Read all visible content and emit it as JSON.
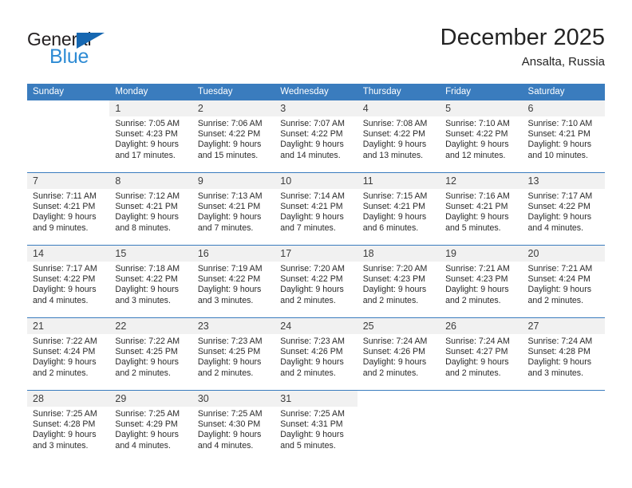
{
  "brand": {
    "name_top": "General",
    "name_bottom": "Blue",
    "triangle_color": "#1667b1",
    "blue_color": "#2e8bd4"
  },
  "header": {
    "month_title": "December 2025",
    "location": "Ansalta, Russia"
  },
  "theme": {
    "header_bg": "#3a7cbe",
    "daynum_bg": "#f1f1f1",
    "grid_line": "#3a7cbe"
  },
  "weekday_headers": [
    "Sunday",
    "Monday",
    "Tuesday",
    "Wednesday",
    "Thursday",
    "Friday",
    "Saturday"
  ],
  "weeks": [
    [
      {
        "day": "",
        "sunrise": "",
        "sunset": "",
        "daylight_line1": "",
        "daylight_line2": ""
      },
      {
        "day": "1",
        "sunrise": "Sunrise: 7:05 AM",
        "sunset": "Sunset: 4:23 PM",
        "daylight_line1": "Daylight: 9 hours",
        "daylight_line2": "and 17 minutes."
      },
      {
        "day": "2",
        "sunrise": "Sunrise: 7:06 AM",
        "sunset": "Sunset: 4:22 PM",
        "daylight_line1": "Daylight: 9 hours",
        "daylight_line2": "and 15 minutes."
      },
      {
        "day": "3",
        "sunrise": "Sunrise: 7:07 AM",
        "sunset": "Sunset: 4:22 PM",
        "daylight_line1": "Daylight: 9 hours",
        "daylight_line2": "and 14 minutes."
      },
      {
        "day": "4",
        "sunrise": "Sunrise: 7:08 AM",
        "sunset": "Sunset: 4:22 PM",
        "daylight_line1": "Daylight: 9 hours",
        "daylight_line2": "and 13 minutes."
      },
      {
        "day": "5",
        "sunrise": "Sunrise: 7:10 AM",
        "sunset": "Sunset: 4:22 PM",
        "daylight_line1": "Daylight: 9 hours",
        "daylight_line2": "and 12 minutes."
      },
      {
        "day": "6",
        "sunrise": "Sunrise: 7:10 AM",
        "sunset": "Sunset: 4:21 PM",
        "daylight_line1": "Daylight: 9 hours",
        "daylight_line2": "and 10 minutes."
      }
    ],
    [
      {
        "day": "7",
        "sunrise": "Sunrise: 7:11 AM",
        "sunset": "Sunset: 4:21 PM",
        "daylight_line1": "Daylight: 9 hours",
        "daylight_line2": "and 9 minutes."
      },
      {
        "day": "8",
        "sunrise": "Sunrise: 7:12 AM",
        "sunset": "Sunset: 4:21 PM",
        "daylight_line1": "Daylight: 9 hours",
        "daylight_line2": "and 8 minutes."
      },
      {
        "day": "9",
        "sunrise": "Sunrise: 7:13 AM",
        "sunset": "Sunset: 4:21 PM",
        "daylight_line1": "Daylight: 9 hours",
        "daylight_line2": "and 7 minutes."
      },
      {
        "day": "10",
        "sunrise": "Sunrise: 7:14 AM",
        "sunset": "Sunset: 4:21 PM",
        "daylight_line1": "Daylight: 9 hours",
        "daylight_line2": "and 7 minutes."
      },
      {
        "day": "11",
        "sunrise": "Sunrise: 7:15 AM",
        "sunset": "Sunset: 4:21 PM",
        "daylight_line1": "Daylight: 9 hours",
        "daylight_line2": "and 6 minutes."
      },
      {
        "day": "12",
        "sunrise": "Sunrise: 7:16 AM",
        "sunset": "Sunset: 4:21 PM",
        "daylight_line1": "Daylight: 9 hours",
        "daylight_line2": "and 5 minutes."
      },
      {
        "day": "13",
        "sunrise": "Sunrise: 7:17 AM",
        "sunset": "Sunset: 4:22 PM",
        "daylight_line1": "Daylight: 9 hours",
        "daylight_line2": "and 4 minutes."
      }
    ],
    [
      {
        "day": "14",
        "sunrise": "Sunrise: 7:17 AM",
        "sunset": "Sunset: 4:22 PM",
        "daylight_line1": "Daylight: 9 hours",
        "daylight_line2": "and 4 minutes."
      },
      {
        "day": "15",
        "sunrise": "Sunrise: 7:18 AM",
        "sunset": "Sunset: 4:22 PM",
        "daylight_line1": "Daylight: 9 hours",
        "daylight_line2": "and 3 minutes."
      },
      {
        "day": "16",
        "sunrise": "Sunrise: 7:19 AM",
        "sunset": "Sunset: 4:22 PM",
        "daylight_line1": "Daylight: 9 hours",
        "daylight_line2": "and 3 minutes."
      },
      {
        "day": "17",
        "sunrise": "Sunrise: 7:20 AM",
        "sunset": "Sunset: 4:22 PM",
        "daylight_line1": "Daylight: 9 hours",
        "daylight_line2": "and 2 minutes."
      },
      {
        "day": "18",
        "sunrise": "Sunrise: 7:20 AM",
        "sunset": "Sunset: 4:23 PM",
        "daylight_line1": "Daylight: 9 hours",
        "daylight_line2": "and 2 minutes."
      },
      {
        "day": "19",
        "sunrise": "Sunrise: 7:21 AM",
        "sunset": "Sunset: 4:23 PM",
        "daylight_line1": "Daylight: 9 hours",
        "daylight_line2": "and 2 minutes."
      },
      {
        "day": "20",
        "sunrise": "Sunrise: 7:21 AM",
        "sunset": "Sunset: 4:24 PM",
        "daylight_line1": "Daylight: 9 hours",
        "daylight_line2": "and 2 minutes."
      }
    ],
    [
      {
        "day": "21",
        "sunrise": "Sunrise: 7:22 AM",
        "sunset": "Sunset: 4:24 PM",
        "daylight_line1": "Daylight: 9 hours",
        "daylight_line2": "and 2 minutes."
      },
      {
        "day": "22",
        "sunrise": "Sunrise: 7:22 AM",
        "sunset": "Sunset: 4:25 PM",
        "daylight_line1": "Daylight: 9 hours",
        "daylight_line2": "and 2 minutes."
      },
      {
        "day": "23",
        "sunrise": "Sunrise: 7:23 AM",
        "sunset": "Sunset: 4:25 PM",
        "daylight_line1": "Daylight: 9 hours",
        "daylight_line2": "and 2 minutes."
      },
      {
        "day": "24",
        "sunrise": "Sunrise: 7:23 AM",
        "sunset": "Sunset: 4:26 PM",
        "daylight_line1": "Daylight: 9 hours",
        "daylight_line2": "and 2 minutes."
      },
      {
        "day": "25",
        "sunrise": "Sunrise: 7:24 AM",
        "sunset": "Sunset: 4:26 PM",
        "daylight_line1": "Daylight: 9 hours",
        "daylight_line2": "and 2 minutes."
      },
      {
        "day": "26",
        "sunrise": "Sunrise: 7:24 AM",
        "sunset": "Sunset: 4:27 PM",
        "daylight_line1": "Daylight: 9 hours",
        "daylight_line2": "and 2 minutes."
      },
      {
        "day": "27",
        "sunrise": "Sunrise: 7:24 AM",
        "sunset": "Sunset: 4:28 PM",
        "daylight_line1": "Daylight: 9 hours",
        "daylight_line2": "and 3 minutes."
      }
    ],
    [
      {
        "day": "28",
        "sunrise": "Sunrise: 7:25 AM",
        "sunset": "Sunset: 4:28 PM",
        "daylight_line1": "Daylight: 9 hours",
        "daylight_line2": "and 3 minutes."
      },
      {
        "day": "29",
        "sunrise": "Sunrise: 7:25 AM",
        "sunset": "Sunset: 4:29 PM",
        "daylight_line1": "Daylight: 9 hours",
        "daylight_line2": "and 4 minutes."
      },
      {
        "day": "30",
        "sunrise": "Sunrise: 7:25 AM",
        "sunset": "Sunset: 4:30 PM",
        "daylight_line1": "Daylight: 9 hours",
        "daylight_line2": "and 4 minutes."
      },
      {
        "day": "31",
        "sunrise": "Sunrise: 7:25 AM",
        "sunset": "Sunset: 4:31 PM",
        "daylight_line1": "Daylight: 9 hours",
        "daylight_line2": "and 5 minutes."
      },
      {
        "day": "",
        "sunrise": "",
        "sunset": "",
        "daylight_line1": "",
        "daylight_line2": ""
      },
      {
        "day": "",
        "sunrise": "",
        "sunset": "",
        "daylight_line1": "",
        "daylight_line2": ""
      },
      {
        "day": "",
        "sunrise": "",
        "sunset": "",
        "daylight_line1": "",
        "daylight_line2": ""
      }
    ]
  ]
}
